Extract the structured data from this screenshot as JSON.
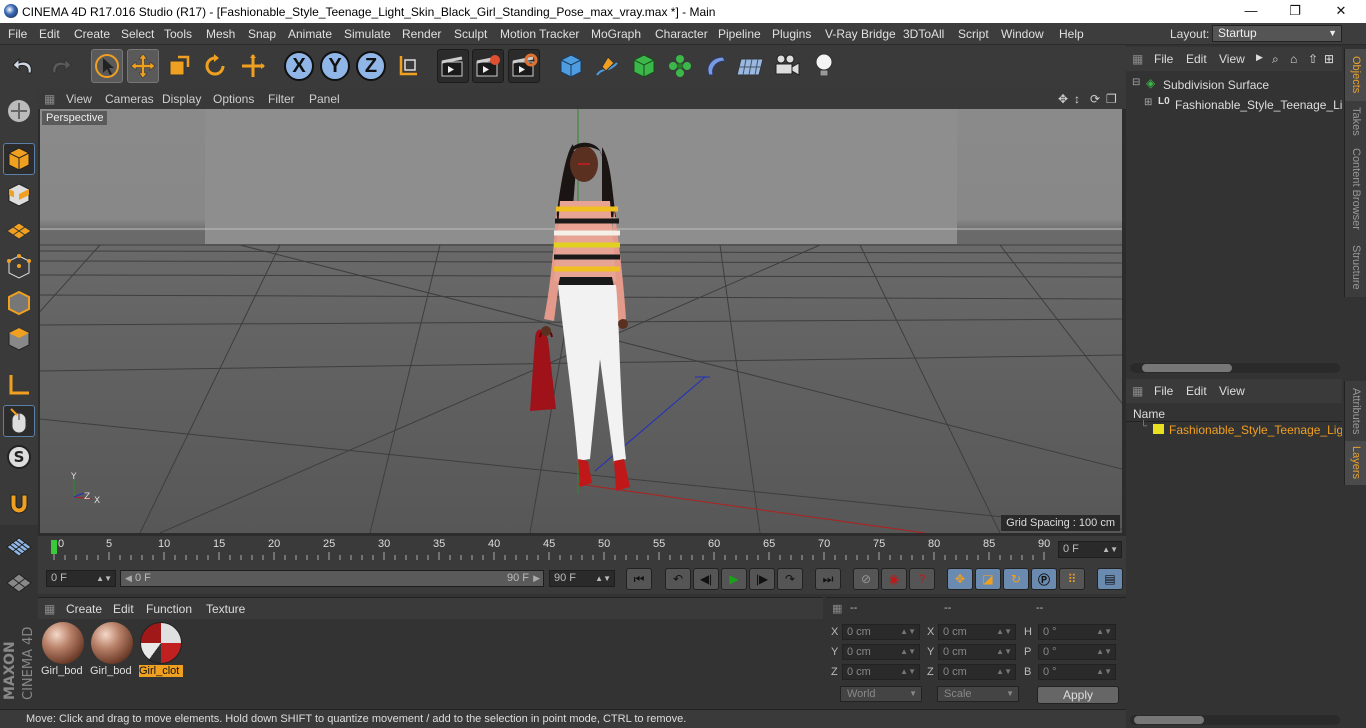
{
  "window": {
    "title": "CINEMA 4D R17.016 Studio (R17) - [Fashionable_Style_Teenage_Light_Skin_Black_Girl_Standing_Pose_max_vray.max *] - Main",
    "minimize": "—",
    "maximize": "❐",
    "close": "✕"
  },
  "menu": [
    "File",
    "Edit",
    "Create",
    "Select",
    "Tools",
    "Mesh",
    "Snap",
    "Animate",
    "Simulate",
    "Render",
    "Sculpt",
    "Motion Tracker",
    "MoGraph",
    "Character",
    "Pipeline",
    "Plugins",
    "V-Ray Bridge",
    "3DToAll",
    "Script",
    "Window",
    "Help"
  ],
  "layout": {
    "label": "Layout:",
    "value": "Startup"
  },
  "viewport": {
    "menu": [
      "View",
      "Cameras",
      "Display",
      "Options",
      "Filter",
      "Panel"
    ],
    "label": "Perspective",
    "grid_spacing": "Grid Spacing : 100 cm",
    "axis_x": "X",
    "axis_y": "Y",
    "axis_z": "Z"
  },
  "timeline": {
    "ticks": [
      "0",
      "5",
      "10",
      "15",
      "20",
      "25",
      "30",
      "35",
      "40",
      "45",
      "50",
      "55",
      "60",
      "65",
      "70",
      "75",
      "80",
      "85",
      "90"
    ],
    "current_frame": "0 F"
  },
  "transport": {
    "start_field": "0 F",
    "range_start": "0 F",
    "range_end": "90 F",
    "end_field": "90 F"
  },
  "materials": {
    "menu": [
      "Create",
      "Edit",
      "Function",
      "Texture"
    ],
    "items": [
      {
        "label": "Girl_bod",
        "selected": false
      },
      {
        "label": "Girl_bod",
        "selected": false
      },
      {
        "label": "Girl_clot",
        "selected": true
      }
    ]
  },
  "coords": {
    "headers": [
      "--",
      "--",
      "--"
    ],
    "rows": [
      {
        "a": "X",
        "pos": "0 cm",
        "b": "X",
        "size": "0 cm",
        "c": "H",
        "rot": "0 °"
      },
      {
        "a": "Y",
        "pos": "0 cm",
        "b": "Y",
        "size": "0 cm",
        "c": "P",
        "rot": "0 °"
      },
      {
        "a": "Z",
        "pos": "0 cm",
        "b": "Z",
        "size": "0 cm",
        "c": "B",
        "rot": "0 °"
      }
    ],
    "mode1": "World",
    "mode2": "Scale",
    "apply": "Apply"
  },
  "status": "Move: Click and drag to move elements. Hold down SHIFT to quantize movement / add to the selection in point mode, CTRL to remove.",
  "objects_panel": {
    "menu": [
      "File",
      "Edit",
      "View"
    ],
    "items": [
      "Subdivision Surface",
      "Fashionable_Style_Teenage_Light"
    ],
    "lo_tag": "L0"
  },
  "layers_panel": {
    "menu": [
      "File",
      "Edit",
      "View"
    ],
    "column": "Name",
    "items": [
      "Fashionable_Style_Teenage_Light"
    ]
  },
  "side_tabs_top": [
    "Objects",
    "Takes",
    "Content Browser",
    "Structure"
  ],
  "side_tabs_bottom": [
    "Attributes",
    "Layers"
  ],
  "brand": {
    "maxon": "MAXON",
    "c4d": "CINEMA 4D"
  },
  "colors": {
    "accent": "#f0a020",
    "layer_yellow": "#e8e020",
    "axis_blue": "#8fb6e6"
  }
}
